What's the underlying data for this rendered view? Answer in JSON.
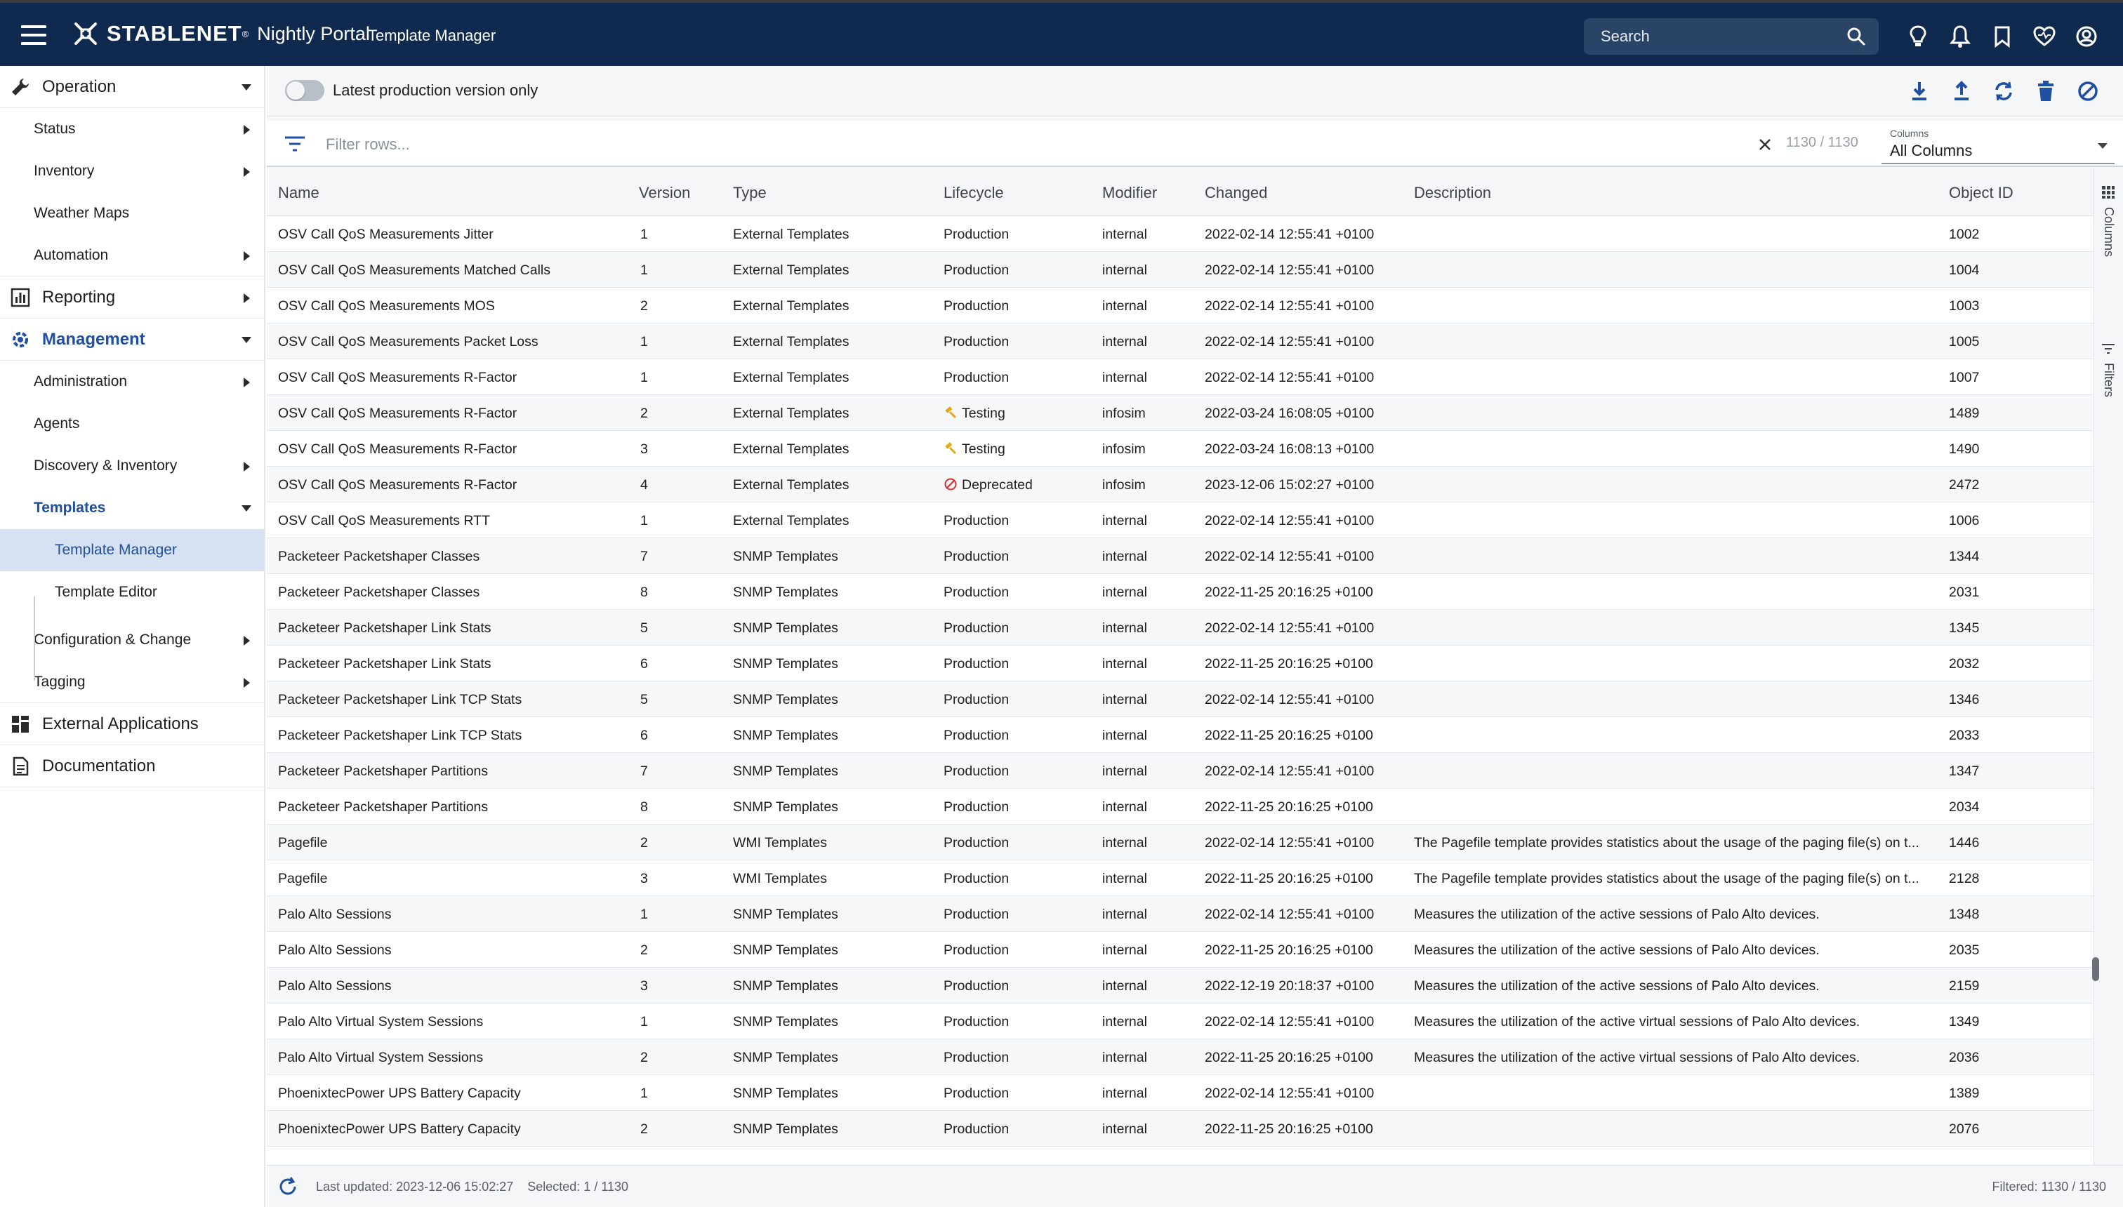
{
  "header": {
    "brand": "STABLENET",
    "brand_mark": "®",
    "portal": "Nightly Portal",
    "page": "Template Manager",
    "search_placeholder": "Search"
  },
  "sidebar": {
    "operation": "Operation",
    "status": "Status",
    "inventory": "Inventory",
    "weather_maps": "Weather Maps",
    "automation": "Automation",
    "reporting": "Reporting",
    "management": "Management",
    "administration": "Administration",
    "agents": "Agents",
    "discovery": "Discovery & Inventory",
    "templates": "Templates",
    "template_manager": "Template Manager",
    "template_editor": "Template Editor",
    "config_change": "Configuration & Change",
    "tagging": "Tagging",
    "external_apps": "External Applications",
    "documentation": "Documentation"
  },
  "toolbar": {
    "toggle_label": "Latest production version only",
    "toggle_on": false
  },
  "filter": {
    "placeholder": "Filter rows...",
    "count": "1130 / 1130",
    "columns_label": "Columns",
    "columns_value": "All Columns"
  },
  "columns": {
    "name": "Name",
    "version": "Version",
    "type": "Type",
    "lifecycle": "Lifecycle",
    "modifier": "Modifier",
    "changed": "Changed",
    "description": "Description",
    "object_id": "Object ID"
  },
  "side_tabs": {
    "columns": "Columns",
    "filters": "Filters"
  },
  "rows": [
    {
      "name": "OSV Call QoS Measurements Jitter",
      "version": "1",
      "type": "External Templates",
      "lifecycle": "Production",
      "modifier": "internal",
      "changed": "2022-02-14 12:55:41 +0100",
      "description": "",
      "object_id": "1002"
    },
    {
      "name": "OSV Call QoS Measurements Matched Calls",
      "version": "1",
      "type": "External Templates",
      "lifecycle": "Production",
      "modifier": "internal",
      "changed": "2022-02-14 12:55:41 +0100",
      "description": "",
      "object_id": "1004"
    },
    {
      "name": "OSV Call QoS Measurements MOS",
      "version": "2",
      "type": "External Templates",
      "lifecycle": "Production",
      "modifier": "internal",
      "changed": "2022-02-14 12:55:41 +0100",
      "description": "",
      "object_id": "1003"
    },
    {
      "name": "OSV Call QoS Measurements Packet Loss",
      "version": "1",
      "type": "External Templates",
      "lifecycle": "Production",
      "modifier": "internal",
      "changed": "2022-02-14 12:55:41 +0100",
      "description": "",
      "object_id": "1005"
    },
    {
      "name": "OSV Call QoS Measurements R-Factor",
      "version": "1",
      "type": "External Templates",
      "lifecycle": "Production",
      "modifier": "internal",
      "changed": "2022-02-14 12:55:41 +0100",
      "description": "",
      "object_id": "1007"
    },
    {
      "name": "OSV Call QoS Measurements R-Factor",
      "version": "2",
      "type": "External Templates",
      "lifecycle": "Testing",
      "modifier": "infosim",
      "changed": "2022-03-24 16:08:05 +0100",
      "description": "",
      "object_id": "1489"
    },
    {
      "name": "OSV Call QoS Measurements R-Factor",
      "version": "3",
      "type": "External Templates",
      "lifecycle": "Testing",
      "modifier": "infosim",
      "changed": "2022-03-24 16:08:13 +0100",
      "description": "",
      "object_id": "1490"
    },
    {
      "name": "OSV Call QoS Measurements R-Factor",
      "version": "4",
      "type": "External Templates",
      "lifecycle": "Deprecated",
      "modifier": "infosim",
      "changed": "2023-12-06 15:02:27 +0100",
      "description": "",
      "object_id": "2472"
    },
    {
      "name": "OSV Call QoS Measurements RTT",
      "version": "1",
      "type": "External Templates",
      "lifecycle": "Production",
      "modifier": "internal",
      "changed": "2022-02-14 12:55:41 +0100",
      "description": "",
      "object_id": "1006"
    },
    {
      "name": "Packeteer Packetshaper Classes",
      "version": "7",
      "type": "SNMP Templates",
      "lifecycle": "Production",
      "modifier": "internal",
      "changed": "2022-02-14 12:55:41 +0100",
      "description": "",
      "object_id": "1344"
    },
    {
      "name": "Packeteer Packetshaper Classes",
      "version": "8",
      "type": "SNMP Templates",
      "lifecycle": "Production",
      "modifier": "internal",
      "changed": "2022-11-25 20:16:25 +0100",
      "description": "",
      "object_id": "2031"
    },
    {
      "name": "Packeteer Packetshaper Link Stats",
      "version": "5",
      "type": "SNMP Templates",
      "lifecycle": "Production",
      "modifier": "internal",
      "changed": "2022-02-14 12:55:41 +0100",
      "description": "",
      "object_id": "1345"
    },
    {
      "name": "Packeteer Packetshaper Link Stats",
      "version": "6",
      "type": "SNMP Templates",
      "lifecycle": "Production",
      "modifier": "internal",
      "changed": "2022-11-25 20:16:25 +0100",
      "description": "",
      "object_id": "2032"
    },
    {
      "name": "Packeteer Packetshaper Link TCP Stats",
      "version": "5",
      "type": "SNMP Templates",
      "lifecycle": "Production",
      "modifier": "internal",
      "changed": "2022-02-14 12:55:41 +0100",
      "description": "",
      "object_id": "1346"
    },
    {
      "name": "Packeteer Packetshaper Link TCP Stats",
      "version": "6",
      "type": "SNMP Templates",
      "lifecycle": "Production",
      "modifier": "internal",
      "changed": "2022-11-25 20:16:25 +0100",
      "description": "",
      "object_id": "2033"
    },
    {
      "name": "Packeteer Packetshaper Partitions",
      "version": "7",
      "type": "SNMP Templates",
      "lifecycle": "Production",
      "modifier": "internal",
      "changed": "2022-02-14 12:55:41 +0100",
      "description": "",
      "object_id": "1347"
    },
    {
      "name": "Packeteer Packetshaper Partitions",
      "version": "8",
      "type": "SNMP Templates",
      "lifecycle": "Production",
      "modifier": "internal",
      "changed": "2022-11-25 20:16:25 +0100",
      "description": "",
      "object_id": "2034"
    },
    {
      "name": "Pagefile",
      "version": "2",
      "type": "WMI Templates",
      "lifecycle": "Production",
      "modifier": "internal",
      "changed": "2022-02-14 12:55:41 +0100",
      "description": "The Pagefile template provides statistics about the usage of the paging file(s) on t...",
      "object_id": "1446"
    },
    {
      "name": "Pagefile",
      "version": "3",
      "type": "WMI Templates",
      "lifecycle": "Production",
      "modifier": "internal",
      "changed": "2022-11-25 20:16:25 +0100",
      "description": "The Pagefile template provides statistics about the usage of the paging file(s) on t...",
      "object_id": "2128"
    },
    {
      "name": "Palo Alto Sessions",
      "version": "1",
      "type": "SNMP Templates",
      "lifecycle": "Production",
      "modifier": "internal",
      "changed": "2022-02-14 12:55:41 +0100",
      "description": "Measures the utilization of the active sessions of Palo Alto devices.",
      "object_id": "1348"
    },
    {
      "name": "Palo Alto Sessions",
      "version": "2",
      "type": "SNMP Templates",
      "lifecycle": "Production",
      "modifier": "internal",
      "changed": "2022-11-25 20:16:25 +0100",
      "description": "Measures the utilization of the active sessions of Palo Alto devices.",
      "object_id": "2035"
    },
    {
      "name": "Palo Alto Sessions",
      "version": "3",
      "type": "SNMP Templates",
      "lifecycle": "Production",
      "modifier": "internal",
      "changed": "2022-12-19 20:18:37 +0100",
      "description": "Measures the utilization of the active sessions of Palo Alto devices.",
      "object_id": "2159"
    },
    {
      "name": "Palo Alto Virtual System Sessions",
      "version": "1",
      "type": "SNMP Templates",
      "lifecycle": "Production",
      "modifier": "internal",
      "changed": "2022-02-14 12:55:41 +0100",
      "description": "Measures the utilization of the active virtual sessions of Palo Alto devices.",
      "object_id": "1349"
    },
    {
      "name": "Palo Alto Virtual System Sessions",
      "version": "2",
      "type": "SNMP Templates",
      "lifecycle": "Production",
      "modifier": "internal",
      "changed": "2022-11-25 20:16:25 +0100",
      "description": "Measures the utilization of the active virtual sessions of Palo Alto devices.",
      "object_id": "2036"
    },
    {
      "name": "PhoenixtecPower UPS Battery Capacity",
      "version": "1",
      "type": "SNMP Templates",
      "lifecycle": "Production",
      "modifier": "internal",
      "changed": "2022-02-14 12:55:41 +0100",
      "description": "",
      "object_id": "1389"
    },
    {
      "name": "PhoenixtecPower UPS Battery Capacity",
      "version": "2",
      "type": "SNMP Templates",
      "lifecycle": "Production",
      "modifier": "internal",
      "changed": "2022-11-25 20:16:25 +0100",
      "description": "",
      "object_id": "2076"
    }
  ],
  "status": {
    "last_updated": "Last updated: 2023-12-06 15:02:27",
    "selected": "Selected: 1 / 1130",
    "filtered": "Filtered: 1130 / 1130"
  },
  "colors": {
    "header_bg": "#0f2a4e",
    "accent": "#1e4fa0",
    "testing": "#e6a817",
    "deprecated": "#d32f2f"
  }
}
